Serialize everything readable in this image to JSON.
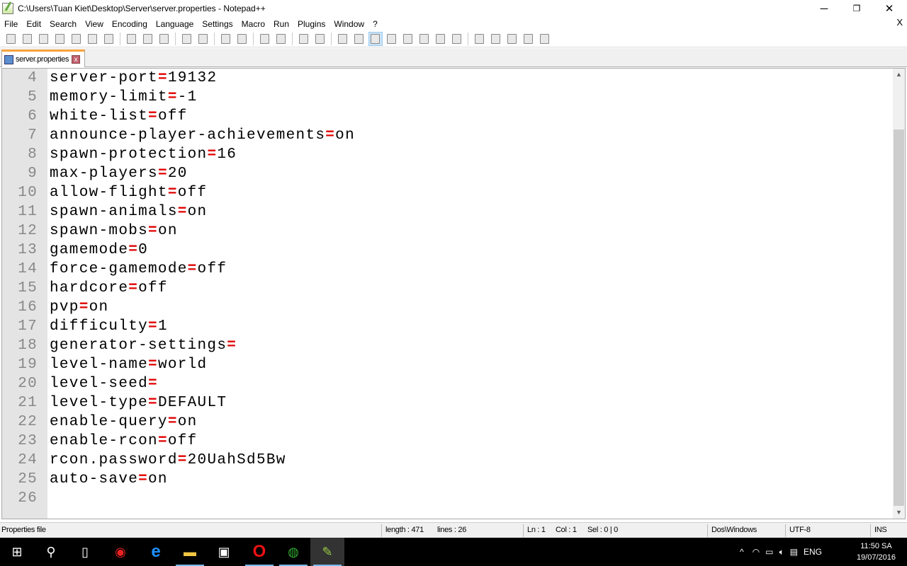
{
  "window": {
    "title": "C:\\Users\\Tuan Kiet\\Desktop\\Server\\server.properties - Notepad++",
    "minimize": "─",
    "restore": "❐",
    "close": "✕"
  },
  "menu": {
    "items": [
      "File",
      "Edit",
      "Search",
      "View",
      "Encoding",
      "Language",
      "Settings",
      "Macro",
      "Run",
      "Plugins",
      "Window",
      "?"
    ],
    "close": "X"
  },
  "toolbar": {
    "icons": [
      "new-file",
      "open-file",
      "save",
      "save-all",
      "close",
      "close-all",
      "print",
      "|",
      "cut",
      "copy",
      "paste",
      "|",
      "undo",
      "redo",
      "|",
      "find",
      "replace",
      "|",
      "zoom-in",
      "zoom-out",
      "|",
      "sync-vertical",
      "sync-horizontal",
      "|",
      "word-wrap",
      "show-all-chars",
      "indent-guide",
      "user-defined-language",
      "document-map",
      "function-list",
      "folder-as-workspace",
      "monitoring",
      "|",
      "record-macro",
      "stop-recording",
      "play-macro",
      "run-macro-multiple",
      "save-macro"
    ],
    "active": "indent-guide"
  },
  "tab": {
    "label": "server.properties",
    "close": "x"
  },
  "editor": {
    "lines": [
      {
        "n": "4",
        "key": "server-port",
        "val": "19132"
      },
      {
        "n": "5",
        "key": "memory-limit",
        "val": "-1"
      },
      {
        "n": "6",
        "key": "white-list",
        "val": "off"
      },
      {
        "n": "7",
        "key": "announce-player-achievements",
        "val": "on"
      },
      {
        "n": "8",
        "key": "spawn-protection",
        "val": "16"
      },
      {
        "n": "9",
        "key": "max-players",
        "val": "20"
      },
      {
        "n": "10",
        "key": "allow-flight",
        "val": "off"
      },
      {
        "n": "11",
        "key": "spawn-animals",
        "val": "on"
      },
      {
        "n": "12",
        "key": "spawn-mobs",
        "val": "on"
      },
      {
        "n": "13",
        "key": "gamemode",
        "val": "0"
      },
      {
        "n": "14",
        "key": "force-gamemode",
        "val": "off"
      },
      {
        "n": "15",
        "key": "hardcore",
        "val": "off"
      },
      {
        "n": "16",
        "key": "pvp",
        "val": "on"
      },
      {
        "n": "17",
        "key": "difficulty",
        "val": "1"
      },
      {
        "n": "18",
        "key": "generator-settings",
        "val": ""
      },
      {
        "n": "19",
        "key": "level-name",
        "val": "world"
      },
      {
        "n": "20",
        "key": "level-seed",
        "val": ""
      },
      {
        "n": "21",
        "key": "level-type",
        "val": "DEFAULT"
      },
      {
        "n": "22",
        "key": "enable-query",
        "val": "on"
      },
      {
        "n": "23",
        "key": "enable-rcon",
        "val": "off"
      },
      {
        "n": "24",
        "key": "rcon.password",
        "val": "20UahSd5Bw"
      },
      {
        "n": "25",
        "key": "auto-save",
        "val": "on"
      },
      {
        "n": "26",
        "key": "",
        "val": ""
      }
    ],
    "eq": "="
  },
  "status": {
    "filetype": "Properties file",
    "length": "length : 471",
    "lines": "lines : 26",
    "ln": "Ln : 1",
    "col": "Col : 1",
    "sel": "Sel : 0 | 0",
    "eol": "Dos\\Windows",
    "encoding": "UTF-8",
    "mode": "INS"
  },
  "taskbar": {
    "lang": "ENG",
    "time": "11:50 SA",
    "date": "19/07/2016"
  }
}
